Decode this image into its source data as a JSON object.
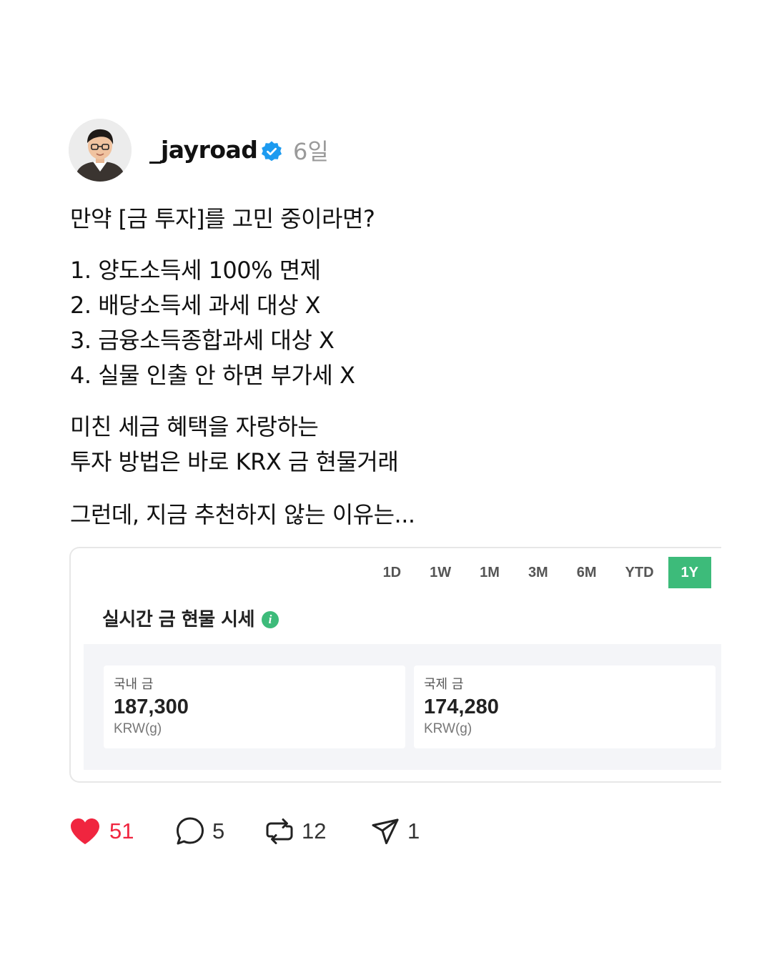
{
  "post": {
    "username": "_jayroad",
    "time_ago": "6일",
    "paragraphs": [
      [
        "만약 [금 투자]를 고민 중이라면?"
      ],
      [
        "1. 양도소득세 100% 면제",
        "2. 배당소득세 과세 대상 X",
        "3. 금융소득종합과세 대상 X",
        "4. 실물 인출 안 하면 부가세 X"
      ],
      [
        "미친 세금 혜택을 자랑하는",
        "투자 방법은 바로 KRX 금 현물거래"
      ],
      [
        "그런데, 지금 추천하지 않는 이유는..."
      ]
    ]
  },
  "card": {
    "range_tabs": [
      "1D",
      "1W",
      "1M",
      "3M",
      "6M",
      "YTD",
      "1Y"
    ],
    "active_range": "1Y",
    "title": "실시간 금 현물 시세",
    "domestic": {
      "label": "국내 금",
      "value": "187,300",
      "unit": "KRW(g)"
    },
    "international": {
      "label": "국제 금",
      "value": "174,280",
      "unit": "KRW(g)"
    }
  },
  "actions": {
    "likes": "51",
    "comments": "5",
    "reposts": "12",
    "shares": "1"
  },
  "colors": {
    "like": "#f0253f",
    "accent_green": "#3dbb7a",
    "verified_blue": "#1d9bf0",
    "muted_text": "#9a9a9a"
  },
  "icons": {
    "verified": "verified-badge-icon",
    "info": "info-icon",
    "like": "heart-icon",
    "comment": "comment-bubble-icon",
    "repost": "repost-icon",
    "share": "paper-plane-icon"
  }
}
